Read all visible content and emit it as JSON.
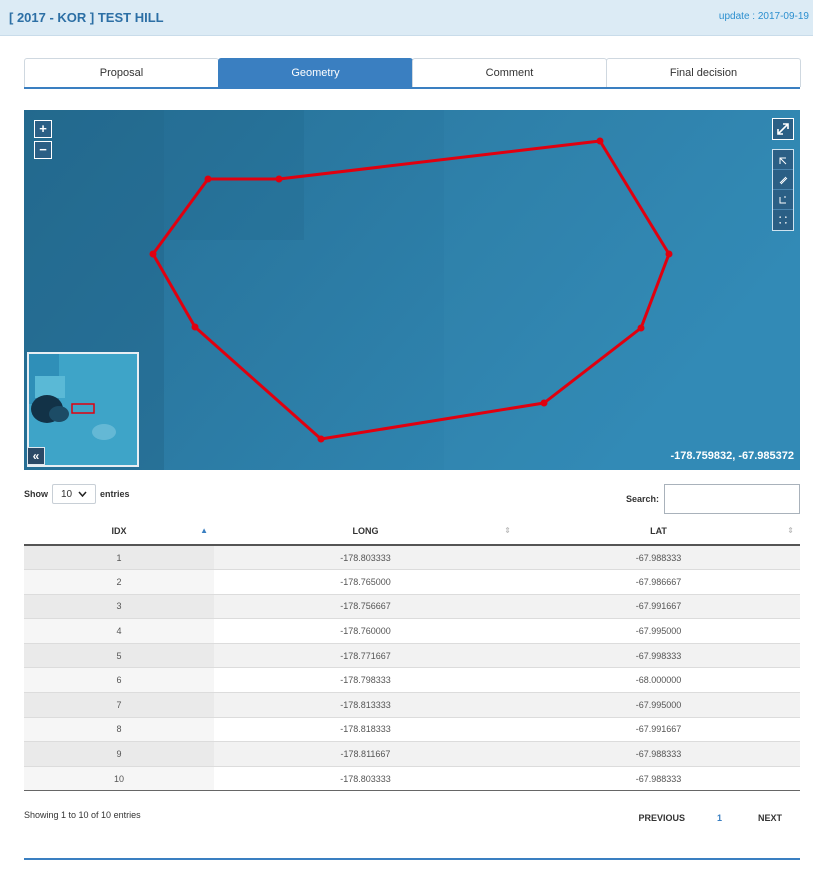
{
  "header": {
    "title": "[ 2017 - KOR ] TEST HILL",
    "update": "update : 2017-09-19"
  },
  "tabs": [
    {
      "label": "Proposal",
      "active": false
    },
    {
      "label": "Geometry",
      "active": true
    },
    {
      "label": "Comment",
      "active": false
    },
    {
      "label": "Final decision",
      "active": false
    }
  ],
  "map": {
    "zoom_in": "+",
    "zoom_out": "−",
    "coordinates": "-178.759832, -67.985372",
    "collapse_label": "«",
    "icons": [
      "fullscreen-icon",
      "draw-marker-icon",
      "draw-polygon-icon",
      "draw-polyline-icon",
      "draw-rectangle-icon",
      "collapse-minimap-icon"
    ],
    "polygon_color": "#e0000f",
    "water_color": "#2f83ad"
  },
  "table_controls": {
    "show_label": "Show",
    "entries_value": "10",
    "entries_label": "entries",
    "search_label": "Search:",
    "search_value": ""
  },
  "table": {
    "columns": [
      "IDX",
      "LONG",
      "LAT"
    ],
    "rows": [
      [
        "1",
        "-178.803333",
        "-67.988333"
      ],
      [
        "2",
        "-178.765000",
        "-67.986667"
      ],
      [
        "3",
        "-178.756667",
        "-67.991667"
      ],
      [
        "4",
        "-178.760000",
        "-67.995000"
      ],
      [
        "5",
        "-178.771667",
        "-67.998333"
      ],
      [
        "6",
        "-178.798333",
        "-68.000000"
      ],
      [
        "7",
        "-178.813333",
        "-67.995000"
      ],
      [
        "8",
        "-178.818333",
        "-67.991667"
      ],
      [
        "9",
        "-178.811667",
        "-67.988333"
      ],
      [
        "10",
        "-178.803333",
        "-67.988333"
      ]
    ]
  },
  "footer": {
    "info": "Showing 1 to 10 of 10 entries",
    "previous": "PREVIOUS",
    "page": "1",
    "next": "NEXT"
  }
}
